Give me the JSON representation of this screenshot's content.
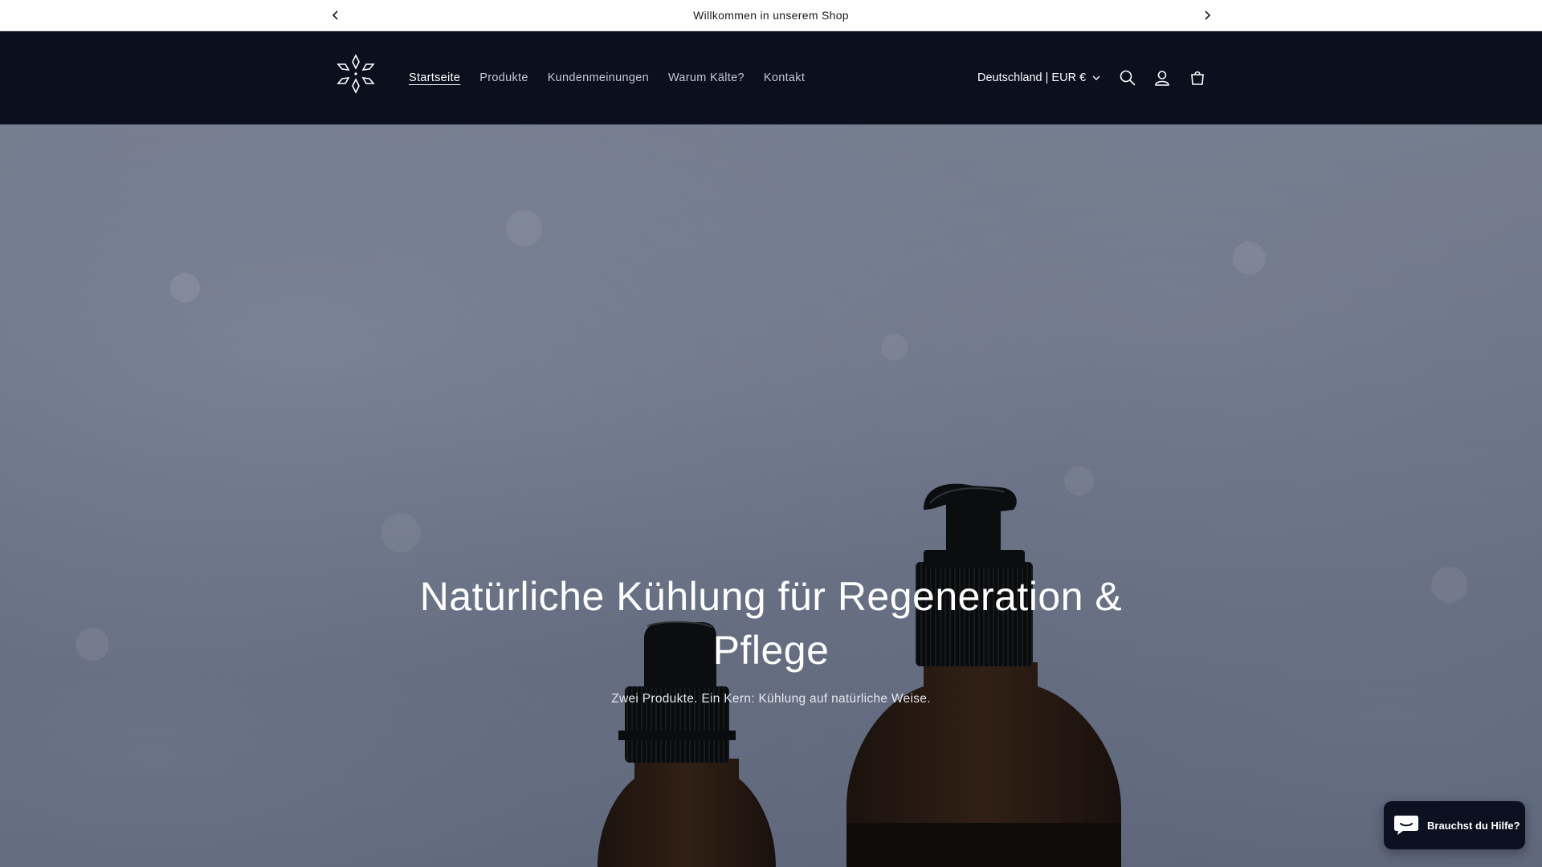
{
  "announcement": {
    "text": "Willkommen in unserem Shop",
    "prev_icon": "chevron-left-icon",
    "next_icon": "chevron-right-icon"
  },
  "header": {
    "logo_icon": "snowflake-logo-icon",
    "nav": [
      {
        "label": "Startseite",
        "active": true
      },
      {
        "label": "Produkte",
        "active": false
      },
      {
        "label": "Kundenmeinungen",
        "active": false
      },
      {
        "label": "Warum Kälte?",
        "active": false
      },
      {
        "label": "Kontakt",
        "active": false
      }
    ],
    "locale": "Deutschland | EUR €",
    "icons": [
      "search-icon",
      "account-icon",
      "cart-icon"
    ],
    "background": "#0b0f1e"
  },
  "hero": {
    "title": "Natürliche Kühlung für Regeneration & Pflege",
    "subtitle": "Zwei Produkte. Ein Kern: Kühlung auf natürliche Weise."
  },
  "chat": {
    "label": "Brauchst du Hilfe?",
    "icon": "chat-bubble-icon"
  }
}
